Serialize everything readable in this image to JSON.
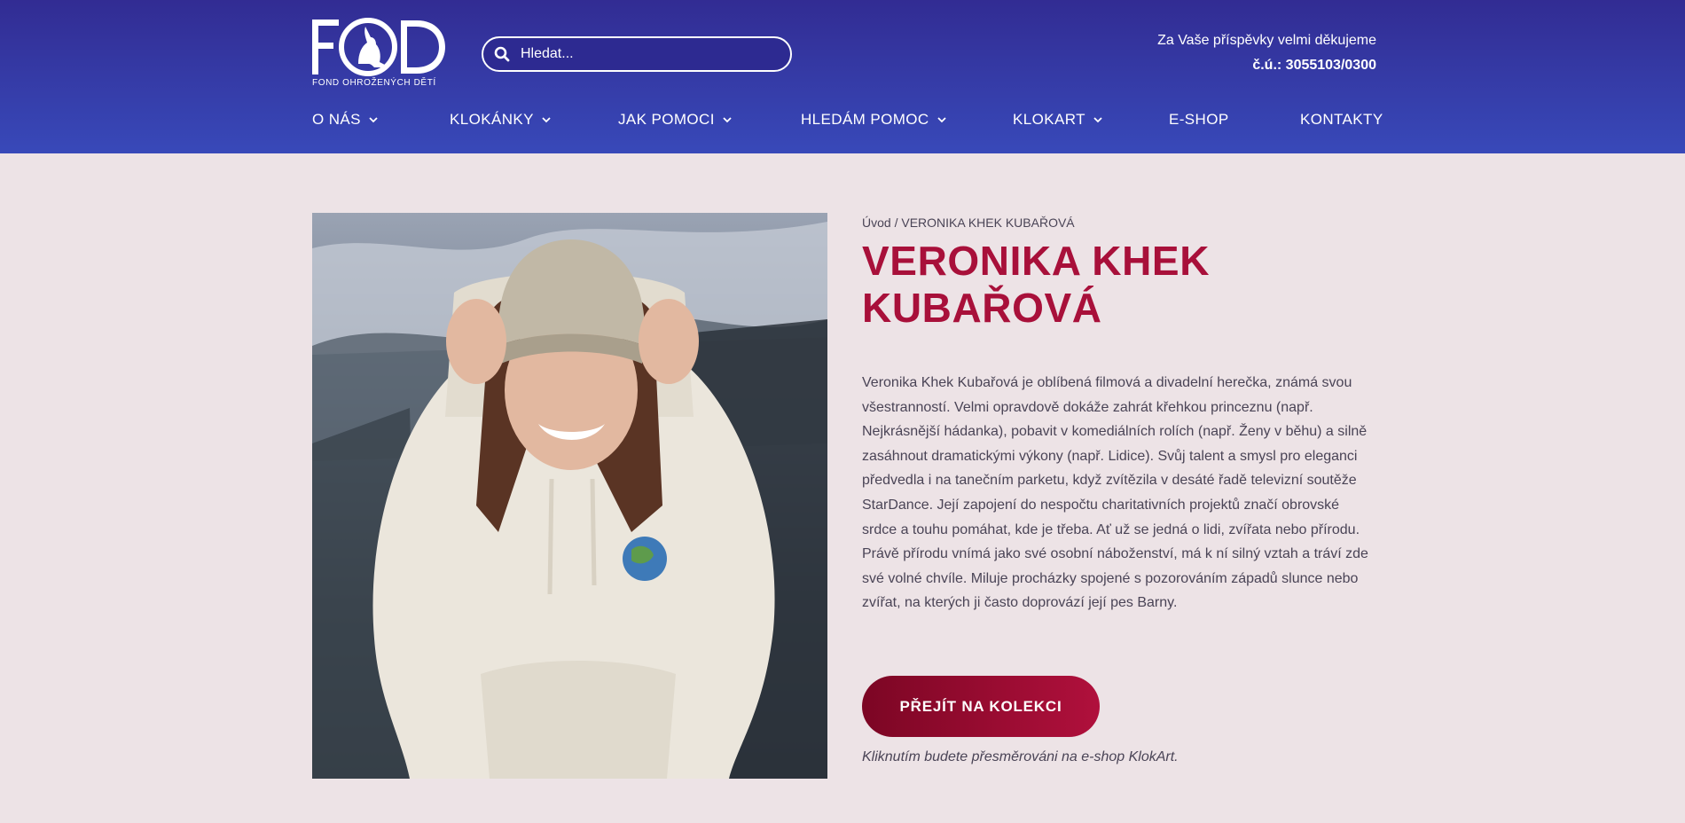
{
  "header": {
    "logo": {
      "letters": "FOD",
      "subtitle": "FOND OHROŽENÝCH DĚTÍ"
    },
    "search": {
      "placeholder": "Hledat...",
      "icon": "search-icon"
    },
    "thanks": {
      "line1": "Za Vaše příspěvky velmi děkujeme",
      "line2": "č.ú.: 3055103/0300"
    }
  },
  "nav": {
    "items": [
      {
        "label": "O NÁS",
        "has_dropdown": true
      },
      {
        "label": "KLOKÁNKY",
        "has_dropdown": true
      },
      {
        "label": "JAK POMOCI",
        "has_dropdown": true
      },
      {
        "label": "HLEDÁM POMOC",
        "has_dropdown": true
      },
      {
        "label": "KLOKART",
        "has_dropdown": true
      },
      {
        "label": "E-SHOP",
        "has_dropdown": false
      },
      {
        "label": "KONTAKTY",
        "has_dropdown": false
      }
    ]
  },
  "breadcrumb": {
    "home": "Úvod",
    "separator": " / ",
    "current": "VERONIKA KHEK KUBAŘOVÁ"
  },
  "main": {
    "title": "VERONIKA KHEK KUBAŘOVÁ",
    "description": "Veronika Khek Kubařová je oblíbená filmová a divadelní herečka, známá svou všestranností. Velmi opravdově dokáže zahrát křehkou princeznu (např. Nejkrásnější hádanka), pobavit v komediálních rolích (např. Ženy v běhu) a silně zasáhnout dramatickými výkony (např. Lidice). Svůj talent a smysl pro eleganci předvedla i na tanečním parketu, když zvítězila v desáté řadě televizní soutěže StarDance. Její zapojení do nespočtu charitativních projektů značí obrovské srdce a touhu pomáhat, kde je třeba. Ať už se jedná o lidi, zvířata nebo přírodu. Právě přírodu vnímá jako své osobní náboženství, má k ní silný vztah a tráví zde své volné chvíle. Miluje procházky spojené s pozorováním západů slunce nebo zvířat, na kterých ji často doprovází její pes Barny.",
    "cta_label": "PŘEJÍT NA KOLEKCI",
    "redirect_note": "Kliknutím budete přesměrováni na e-shop KlokArt."
  },
  "colors": {
    "header_top": "#322c93",
    "header_bottom": "#3849b9",
    "background": "#ede3e6",
    "accent": "#a8103a",
    "button_start": "#7c0624",
    "button_end": "#b0103c"
  }
}
